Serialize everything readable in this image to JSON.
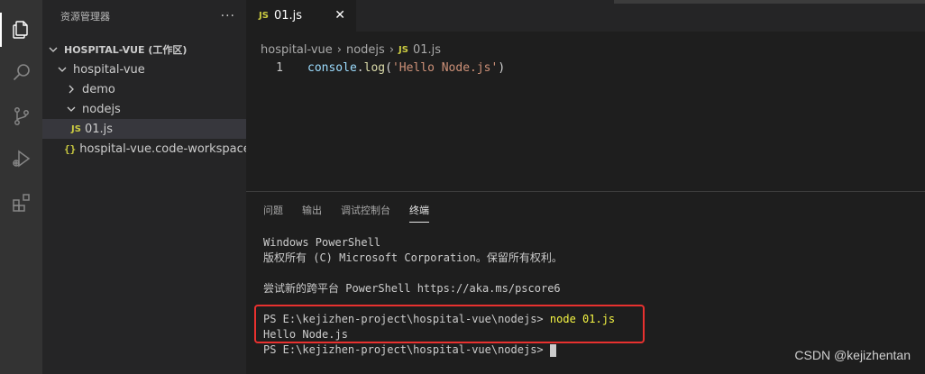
{
  "activity_bar": {
    "icons": [
      "explorer-icon",
      "search-icon",
      "source-control-icon",
      "run-debug-icon",
      "extensions-icon"
    ]
  },
  "sidebar": {
    "title": "资源管理器",
    "more_label": "···",
    "tree": [
      {
        "label": "HOSPITAL-VUE (工作区)",
        "kind": "root",
        "expanded": true
      },
      {
        "label": "hospital-vue",
        "kind": "folder",
        "expanded": true
      },
      {
        "label": "demo",
        "kind": "folder",
        "expanded": false
      },
      {
        "label": "nodejs",
        "kind": "folder",
        "expanded": true
      },
      {
        "label": "01.js",
        "kind": "js-file",
        "badge": "JS",
        "selected": true
      },
      {
        "label": "hospital-vue.code-workspace",
        "kind": "workspace-file",
        "badge": "{}"
      }
    ]
  },
  "editor": {
    "tab": {
      "badge": "JS",
      "label": "01.js",
      "close": "✕"
    },
    "breadcrumb": [
      "hospital-vue",
      "nodejs",
      "01.js"
    ],
    "breadcrumb_sep": "›",
    "breadcrumb_badge": "JS",
    "code": {
      "line_number": "1",
      "tokens": {
        "ident": "console",
        "dot": ".",
        "fn": "log",
        "open": "(",
        "string": "'Hello Node.js'",
        "close": ")"
      }
    }
  },
  "panel": {
    "tabs": [
      "问题",
      "输出",
      "调试控制台",
      "终端"
    ],
    "active_tab": "终端",
    "terminal": {
      "l1": "Windows PowerShell",
      "l2": "版权所有 (C) Microsoft Corporation。保留所有权利。",
      "l3": "尝试新的跨平台 PowerShell https://aka.ms/pscore6",
      "prompt": "PS E:\\kejizhen-project\\hospital-vue\\nodejs> ",
      "command": "node 01.js",
      "output": "Hello Node.js",
      "prompt2": "PS E:\\kejizhen-project\\hospital-vue\\nodejs> "
    }
  },
  "watermark": "CSDN @kejizhentan",
  "colors": {
    "accent_js": "#cbcb41",
    "highlight_box": "#e8312f",
    "command": "#f5f543"
  }
}
